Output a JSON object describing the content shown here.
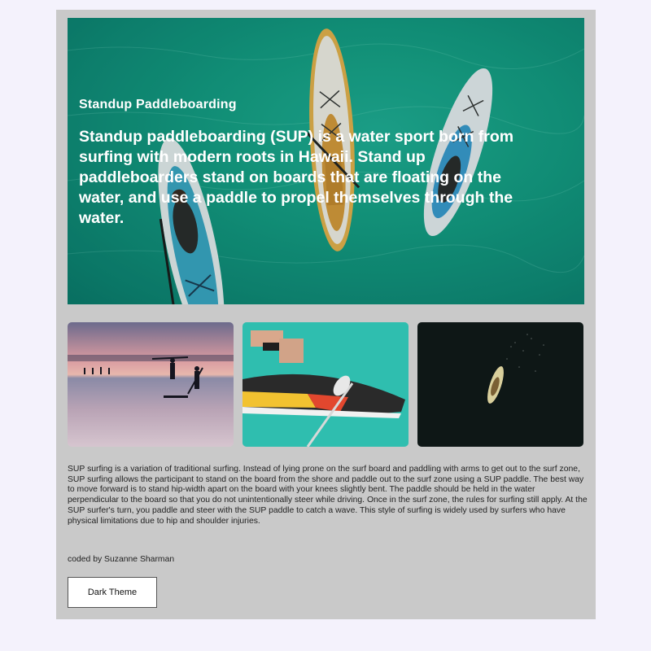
{
  "hero": {
    "title": "Standup Paddleboarding",
    "body": "Standup paddleboarding (SUP) is a water sport born from surfing with modern roots in Hawaii. Stand up paddleboarders stand on boards that are floating on the water, and use a paddle to propel themselves through the water."
  },
  "gallery": [
    {
      "name": "sunset-paddlers-photo"
    },
    {
      "name": "board-closeup-photo"
    },
    {
      "name": "dark-water-aerial-photo"
    }
  ],
  "description": "SUP surfing is a variation of traditional surfing. Instead of lying prone on the surf board and paddling with arms to get out to the surf zone, SUP surfing allows the participant to stand on the board from the shore and paddle out to the surf zone using a SUP paddle. The best way to move forward is to stand hip-width apart on the board with your knees slightly bent. The paddle should be held in the water perpendicular to the board so that you do not unintentionally steer while driving. Once in the surf zone, the rules for surfing still apply. At the SUP surfer's turn, you paddle and steer with the SUP paddle to catch a wave. This style of surfing is widely used by surfers who have physical limitations due to hip and shoulder injuries.",
  "credit": "coded by Suzanne Sharman",
  "theme_button": {
    "label": "Dark Theme"
  },
  "colors": {
    "page_bg": "#f4f2fc",
    "card_bg": "#c9c9c9",
    "water": "#15a085"
  }
}
